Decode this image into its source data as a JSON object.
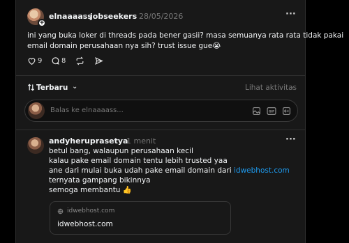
{
  "post": {
    "author": "elnaaaass",
    "separator": "›",
    "community": "jobseekers",
    "date": "28/05/2026",
    "more": "···",
    "text_line1": "ini yang buka loker di threads pada bener gasii? masa semuanya rata rata tidak pakai",
    "text_line2": "email domain perusahaan nya sih? trust issue gue😭",
    "likes": "9",
    "comments": "8"
  },
  "sort": {
    "label": "Terbaru",
    "activity": "Lihat aktivitas"
  },
  "reply_box": {
    "placeholder": "Balas ke elnaaaass..."
  },
  "reply": {
    "author": "andyheruprasetya",
    "time": "1 menit",
    "more": "···",
    "line1": "betul bang, walaupun perusahaan kecil",
    "line2": "kalau pake email domain tentu lebih trusted yaa",
    "line3_prefix": "ane dari mulai buka udah pake email domain dari ",
    "line3_link": "idwebhost.com",
    "line4": "ternyata gampang bikinnya",
    "line5": "semoga membantu 👍",
    "preview_domain": "idwebhost.com",
    "preview_title": "idwebhost.com"
  }
}
